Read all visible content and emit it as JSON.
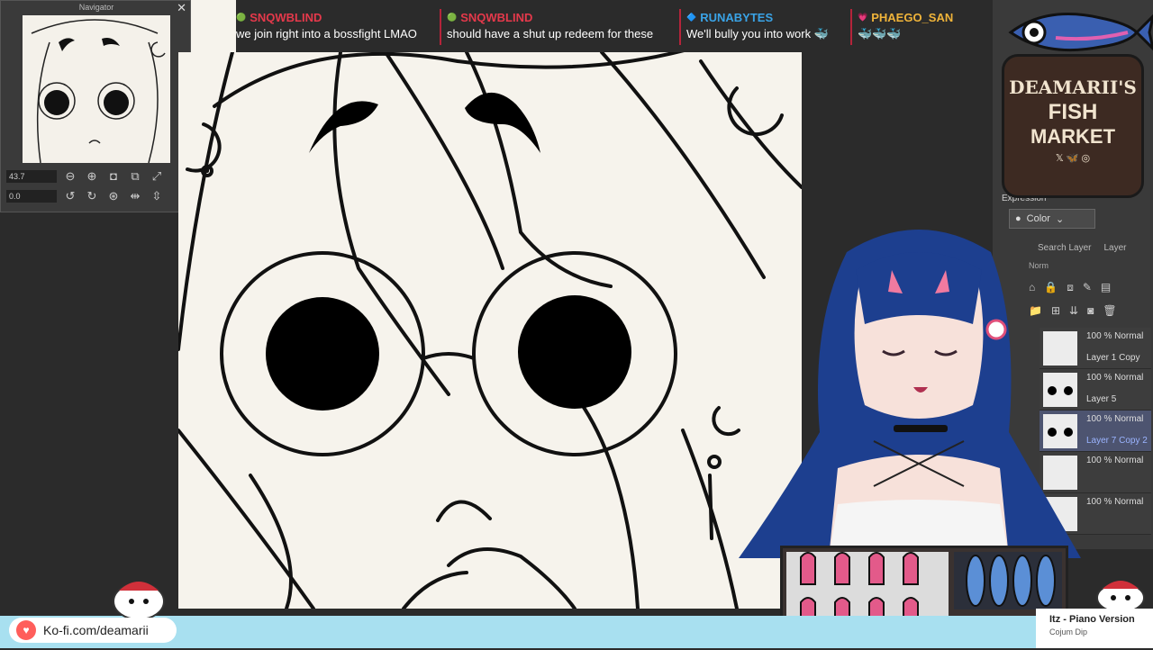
{
  "chat": [
    {
      "user": "SNQWBLIND",
      "color": "#e5394b",
      "text": "we join right into a bossfight LMAO"
    },
    {
      "user": "SNQWBLIND",
      "color": "#e5394b",
      "text": "should have a shut up redeem for these"
    },
    {
      "user": "RUNABYTES",
      "color": "#3aa3e6",
      "text": "We'll bully you into work 🐳"
    },
    {
      "user": "PHAEGO_SAN",
      "color": "#f0b43a",
      "text": "🐳🐳🐳"
    }
  ],
  "navigator": {
    "title": "Navigator",
    "zoom": "43.7",
    "rotation": "0.0"
  },
  "logo": {
    "line1": "DEAMARII'S",
    "line2": "FISH",
    "line3": "MARKET",
    "socials": "𝕏 🦋 ◎"
  },
  "layers_panel": {
    "expression_label": "Expression",
    "color_mode": "Color",
    "search_placeholder": "Search Layer",
    "layer_tab": "Layer",
    "blend_label": "Norm",
    "layers": [
      {
        "mode": "100 % Normal",
        "name": "Layer 1 Copy",
        "selected": false
      },
      {
        "mode": "100 % Normal",
        "name": "Layer 5",
        "selected": false
      },
      {
        "mode": "100 % Normal",
        "name": "Layer 7 Copy 2",
        "selected": true
      },
      {
        "mode": "100 % Normal",
        "name": "",
        "selected": false
      },
      {
        "mode": "100 % Normal",
        "name": "",
        "selected": false
      }
    ]
  },
  "kofi": {
    "text": "Ko-fi.com/deamarii"
  },
  "music": {
    "title": "Itz - Piano Version",
    "artist": "Cojum Dip"
  },
  "colors": {
    "bottom_bar": "#a8e0f0",
    "chat_divider": "#b5243a",
    "canvas": "#f6f3ec"
  }
}
